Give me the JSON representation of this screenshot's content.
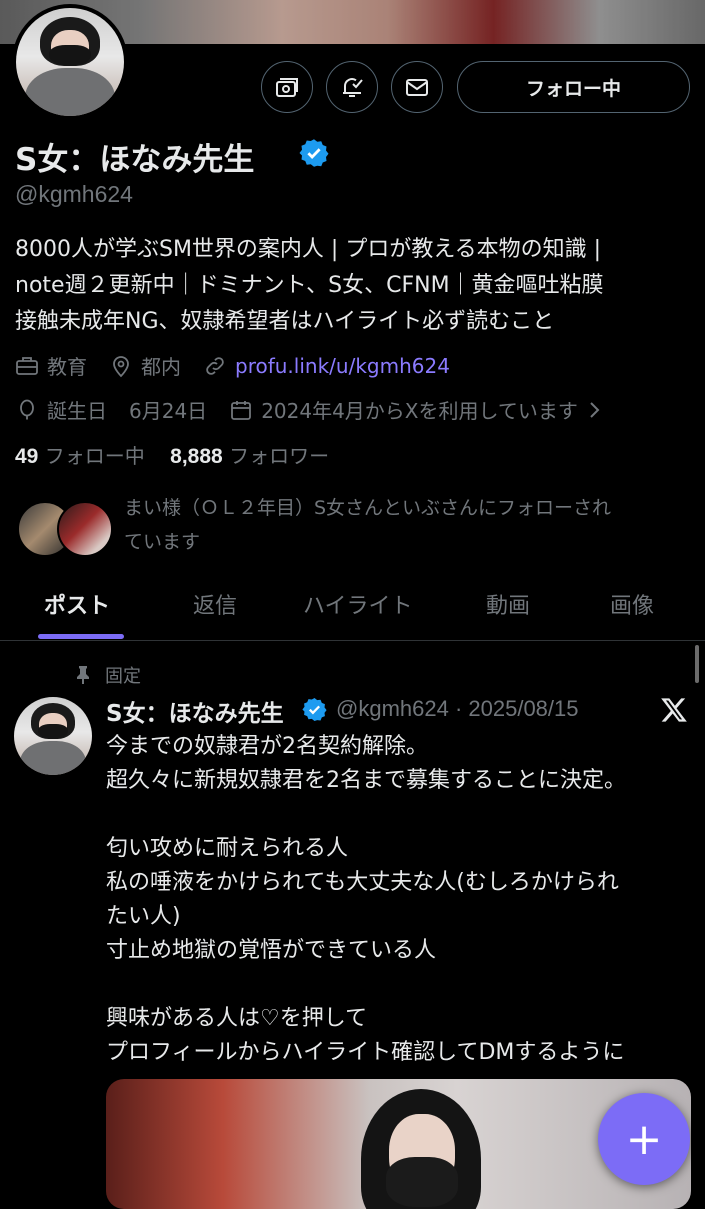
{
  "profile": {
    "name": "S女：ほなみ先生",
    "handle": "@kgmh624",
    "follow_label": "フォロー中",
    "bio": [
      "8000人が学ぶSM世界の案内人 | プロが教える本物の知識 |",
      "note週２更新中｜ドミナント、S女、CFNM｜黄金嘔吐粘膜",
      "接触未成年NG、奴隷希望者はハイライト必ず読むこと"
    ],
    "category": "教育",
    "location": "都内",
    "link": "profu.link/u/kgmh624",
    "birthday_label": "誕生日",
    "birthday": "6月24日",
    "joined": "2024年4月からXを利用しています",
    "following_count": "49",
    "following_label": "フォロー中",
    "followers_count": "8,888",
    "followers_label": "フォロワー",
    "known_followers_line1": "まい様（ＯＬ２年目）S女さんといぶさんにフォローされ",
    "known_followers_line2": "ています"
  },
  "tabs": [
    "ポスト",
    "返信",
    "ハイライト",
    "動画",
    "画像"
  ],
  "post": {
    "pinned_label": "固定",
    "author": "S女：ほなみ先生",
    "handle_date": "@kgmh624 · 2025/08/15",
    "lines": [
      "今までの奴隷君が2名契約解除。",
      "超久々に新規奴隷君を2名まで募集することに決定。",
      "",
      "匂い攻めに耐えられる人",
      "私の唾液をかけられても大丈夫な人(むしろかけられ",
      "たい人)",
      "寸止め地獄の覚悟ができている人",
      "",
      "興味がある人は♡を押して",
      "プロフィールからハイライト確認してDMするように"
    ]
  },
  "fab_label": "+",
  "colors": {
    "accent": "#7c6cf6",
    "verified": "#1d9bf0",
    "link": "#8b7bff"
  }
}
